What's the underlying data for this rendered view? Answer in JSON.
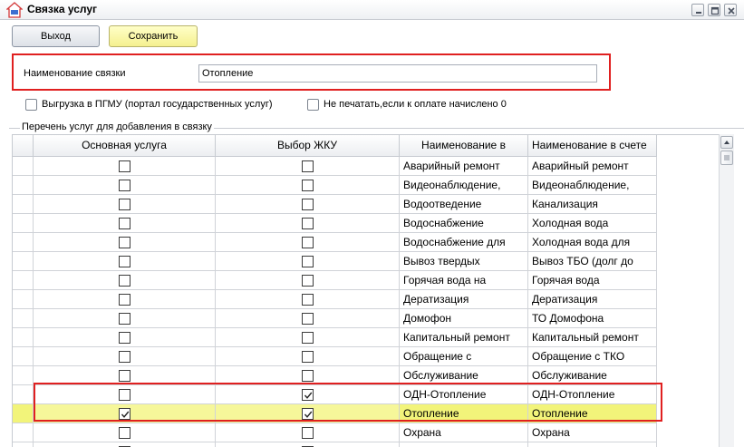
{
  "window": {
    "title": "Связка услуг"
  },
  "toolbar": {
    "exit_label": "Выход",
    "save_label": "Сохранить"
  },
  "form": {
    "name_label": "Наименование связки",
    "name_value": "Отопление",
    "export_label": "Выгрузка в ПГМУ (портал государственных услуг)",
    "no_print_label": "Не печатать,если к оплате начислено 0",
    "group_title": "Перечень услуг для добавления в связку"
  },
  "grid": {
    "columns": [
      "Основная услуга",
      "Выбор ЖКУ",
      "Наименование в",
      "Наименование в счете"
    ],
    "rows": [
      {
        "main": false,
        "jku": false,
        "name": "Аварийный  ремонт",
        "bill": "Аварийный  ремонт",
        "selected": false
      },
      {
        "main": false,
        "jku": false,
        "name": "Видеонаблюдение,",
        "bill": "Видеонаблюдение,",
        "selected": false
      },
      {
        "main": false,
        "jku": false,
        "name": "Водоотведение",
        "bill": "Канализация",
        "selected": false
      },
      {
        "main": false,
        "jku": false,
        "name": "Водоснабжение",
        "bill": "Холодная вода",
        "selected": false
      },
      {
        "main": false,
        "jku": false,
        "name": "Водоснабжение для",
        "bill": "Холодная вода для",
        "selected": false
      },
      {
        "main": false,
        "jku": false,
        "name": "Вывоз твердых",
        "bill": "Вывоз ТБО (долг до",
        "selected": false
      },
      {
        "main": false,
        "jku": false,
        "name": "Горячая вода на",
        "bill": "Горячая вода",
        "selected": false
      },
      {
        "main": false,
        "jku": false,
        "name": "Дератизация",
        "bill": "Дератизация",
        "selected": false
      },
      {
        "main": false,
        "jku": false,
        "name": "Домофон",
        "bill": "ТО Домофона",
        "selected": false
      },
      {
        "main": false,
        "jku": false,
        "name": "Капитальный ремонт",
        "bill": "Капитальный ремонт",
        "selected": false
      },
      {
        "main": false,
        "jku": false,
        "name": "Обращение с",
        "bill": "Обращение с ТКО",
        "selected": false
      },
      {
        "main": false,
        "jku": false,
        "name": "Обслуживание",
        "bill": "Обслуживание",
        "selected": false
      },
      {
        "main": false,
        "jku": true,
        "name": "ОДН-Отопление",
        "bill": "ОДН-Отопление",
        "selected": false
      },
      {
        "main": true,
        "jku": true,
        "name": "Отопление",
        "bill": "Отопление",
        "selected": true
      },
      {
        "main": false,
        "jku": false,
        "name": "Охрана",
        "bill": "Охрана",
        "selected": false
      },
      {
        "main": false,
        "jku": false,
        "name": "",
        "bill": "",
        "selected": false
      }
    ]
  },
  "colors": {
    "selected_row": "#f2f47a",
    "highlight_frame": "#e02020",
    "save_button": "#f5f08f"
  },
  "icons": [
    "app-logo-icon",
    "minimize-icon",
    "restore-icon",
    "close-icon",
    "checkbox-check-icon",
    "scroll-up-icon"
  ]
}
